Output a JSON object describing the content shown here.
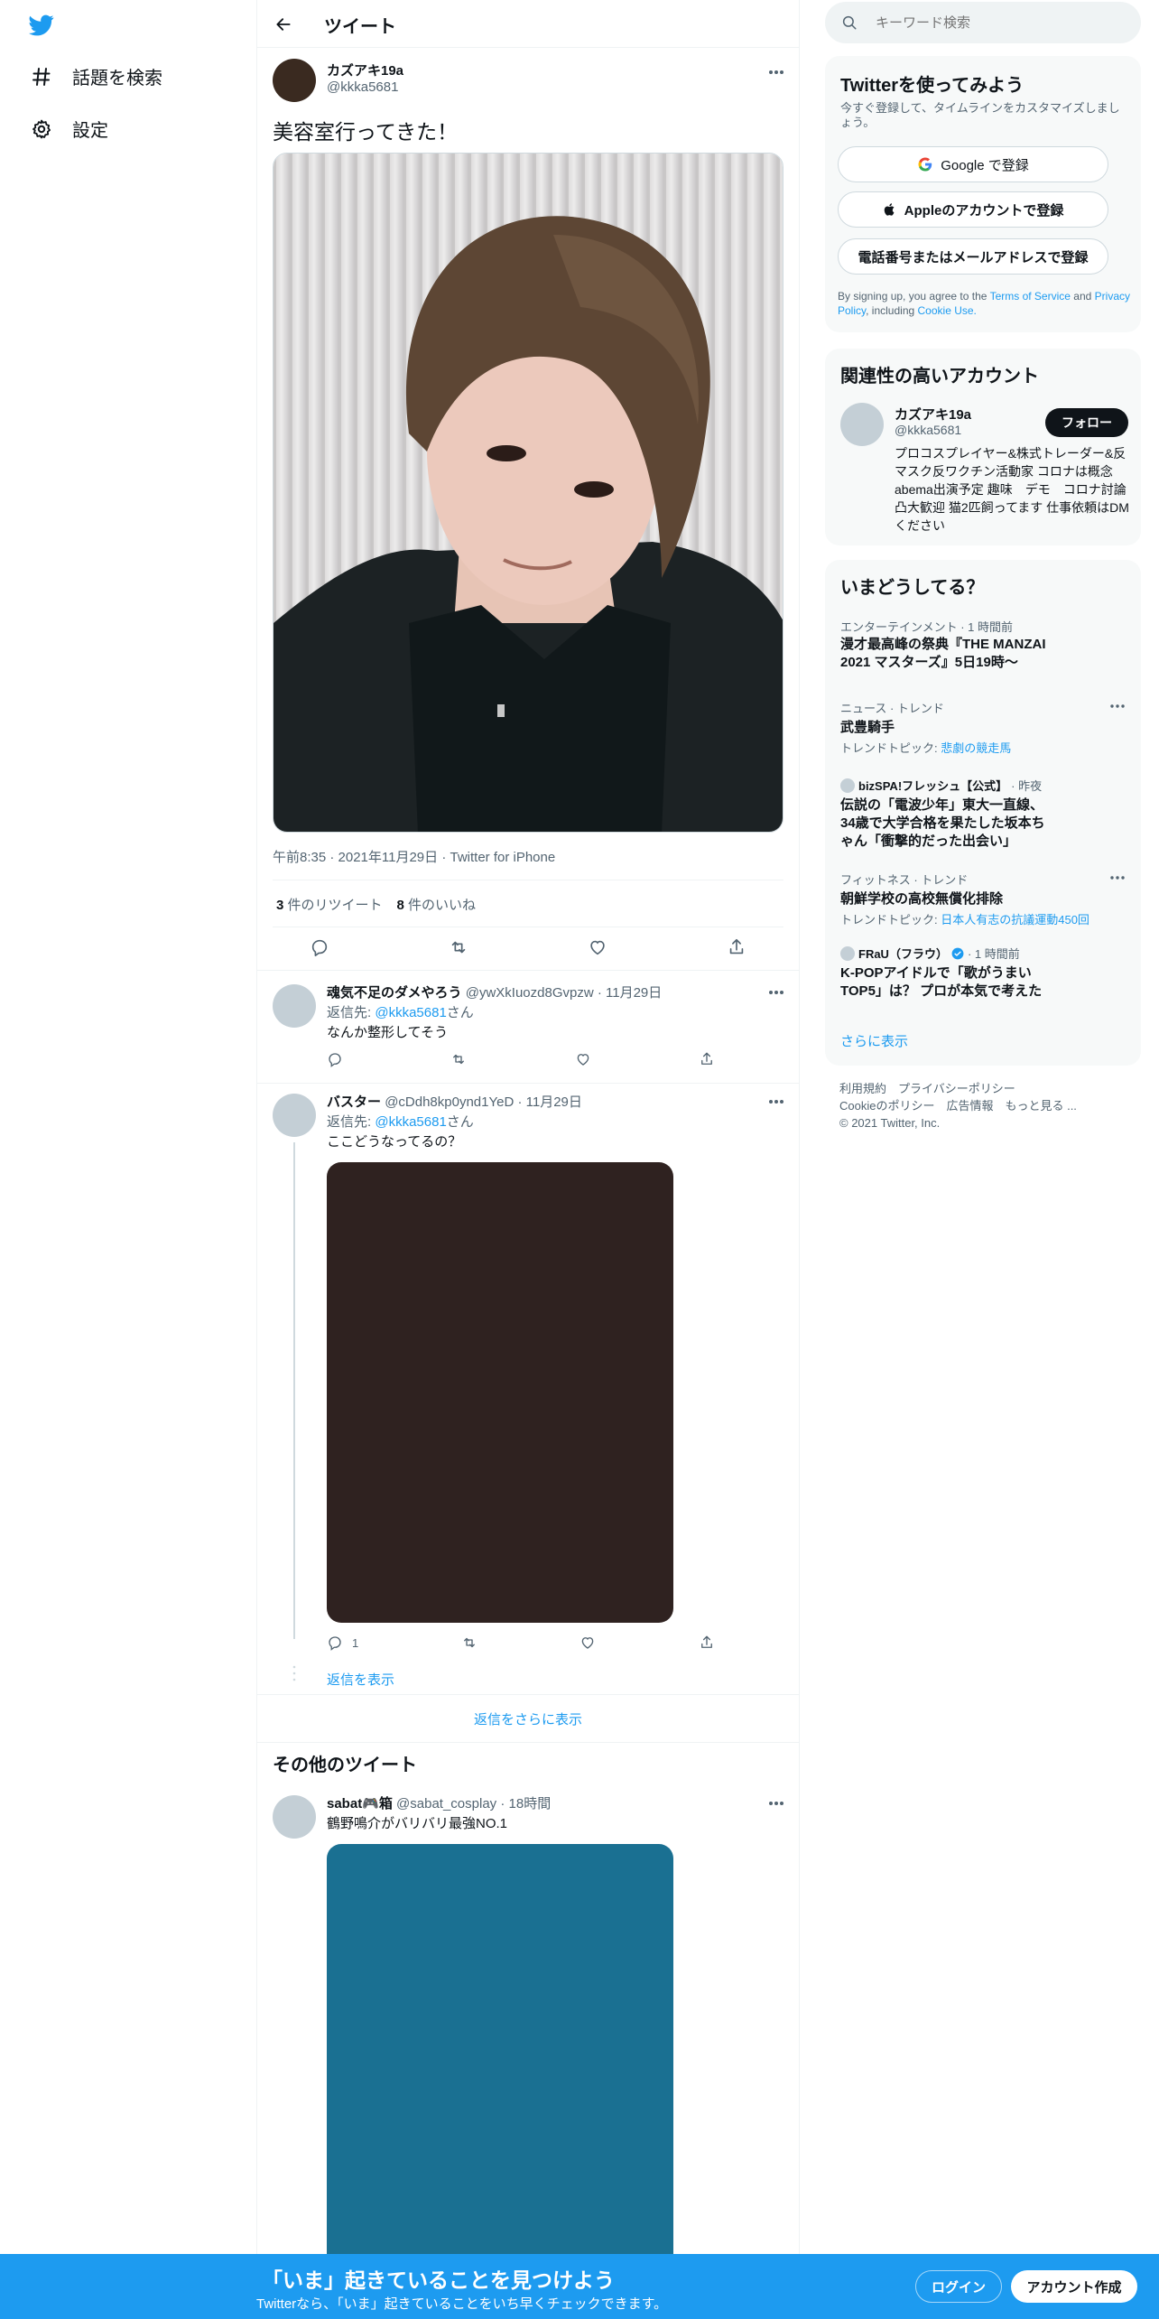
{
  "nav": {
    "explore_label": "話題を検索",
    "settings_label": "設定"
  },
  "header": {
    "title": "ツイート"
  },
  "tweet": {
    "name": "カズアキ19a",
    "handle": "@kkka5681",
    "text": "美容室行ってきた！",
    "meta": "午前8:35 · 2021年11月29日 · Twitter for iPhone",
    "retweet_count": "3",
    "retweet_label": "件のリツイート",
    "like_count": "8",
    "like_label": "件のいいね"
  },
  "replies": [
    {
      "name": "魂気不足のダメやろう",
      "handle": "@ywXkIuozd8Gvpzw",
      "time": "· 11月29日",
      "reply_to_prefix": "返信先:",
      "reply_to_handle": "@kkka5681",
      "reply_to_suffix": "さん",
      "text": "なんか整形してそう"
    },
    {
      "name": "バスター",
      "handle": "@cDdh8kp0ynd1YeD",
      "time": "· 11月29日",
      "reply_to_prefix": "返信先:",
      "reply_to_handle": "@kkka5681",
      "reply_to_suffix": "さん",
      "text": "ここどうなってるの？",
      "reply_count": "1",
      "show_replies": "返信を表示"
    }
  ],
  "show_more_replies": "返信をさらに表示",
  "more_tweets": {
    "title": "その他のツイート",
    "name": "sabat🎮箱",
    "handle": "@sabat_cosplay",
    "time": "· 18時間",
    "text": "鶴野鳴介がバリバリ最強NO.1"
  },
  "search": {
    "placeholder": "キーワード検索"
  },
  "signup": {
    "title": "Twitterを使ってみよう",
    "subtitle": "今すぐ登録して、タイムラインをカスタマイズしましょう。",
    "google_label": "Google で登録",
    "apple_label": "Appleのアカウントで登録",
    "phone_label": "電話番号またはメールアドレスで登録",
    "terms_prefix": "By signing up, you agree to the",
    "terms_link": "Terms of Service",
    "terms_and": "and",
    "privacy_link": "Privacy Policy",
    "terms_including": ", including",
    "cookie_link": "Cookie Use."
  },
  "related": {
    "title": "関連性の高いアカウント",
    "name": "カズアキ19a",
    "handle": "@kkka5681",
    "follow_label": "フォロー",
    "bio": "プロコスプレイヤー&株式トレーダー&反マスク反ワクチン活動家 コロナは概念 abema出演予定 趣味　デモ　コロナ討論 凸大歓迎 猫2匹飼ってます 仕事依頼はDMください"
  },
  "trends": {
    "title": "いまどうしてる？",
    "items": [
      {
        "context": "エンターテインメント · 1 時間前",
        "title": "漫才最高峰の祭典『THE MANZAI 2021 マスターズ』5日19時〜"
      },
      {
        "context": "ニュース · トレンド",
        "title": "武豊騎手",
        "sub_prefix": "トレンドトピック: ",
        "sub_link": "悲劇の競走馬"
      },
      {
        "context_name": "bizSPA!フレッシュ【公式】",
        "context": "· 昨夜",
        "title": "伝説の「電波少年」東大一直線、34歳で大学合格を果たした坂本ちゃん「衝撃的だった出会い」"
      },
      {
        "context": "フィットネス · トレンド",
        "title": "朝鮮学校の高校無償化排除",
        "sub_prefix": "トレンドトピック: ",
        "sub_link": "日本人有志の抗議運動450回"
      },
      {
        "context_name": "FRaU（フラウ）",
        "context": "· 1 時間前",
        "title": "K-POPアイドルで「歌がうまいTOP5」は？ プロが本気で考えた"
      }
    ],
    "show_more": "さらに表示"
  },
  "footer": {
    "line1": "利用規約　プライバシーポリシー",
    "line2": "Cookieのポリシー　広告情報　もっと見る ...",
    "line3": "© 2021 Twitter, Inc."
  },
  "bottom_bar": {
    "title": "「いま」起きていることを見つけよう",
    "subtitle": "Twitterなら、「いま」起きていることをいち早くチェックできます。",
    "login_label": "ログイン",
    "signup_label": "アカウント作成"
  },
  "colors": {
    "accent": "#1d9bf0",
    "photo_dark": "#2f2220",
    "photo_teal": "#1a7092"
  }
}
